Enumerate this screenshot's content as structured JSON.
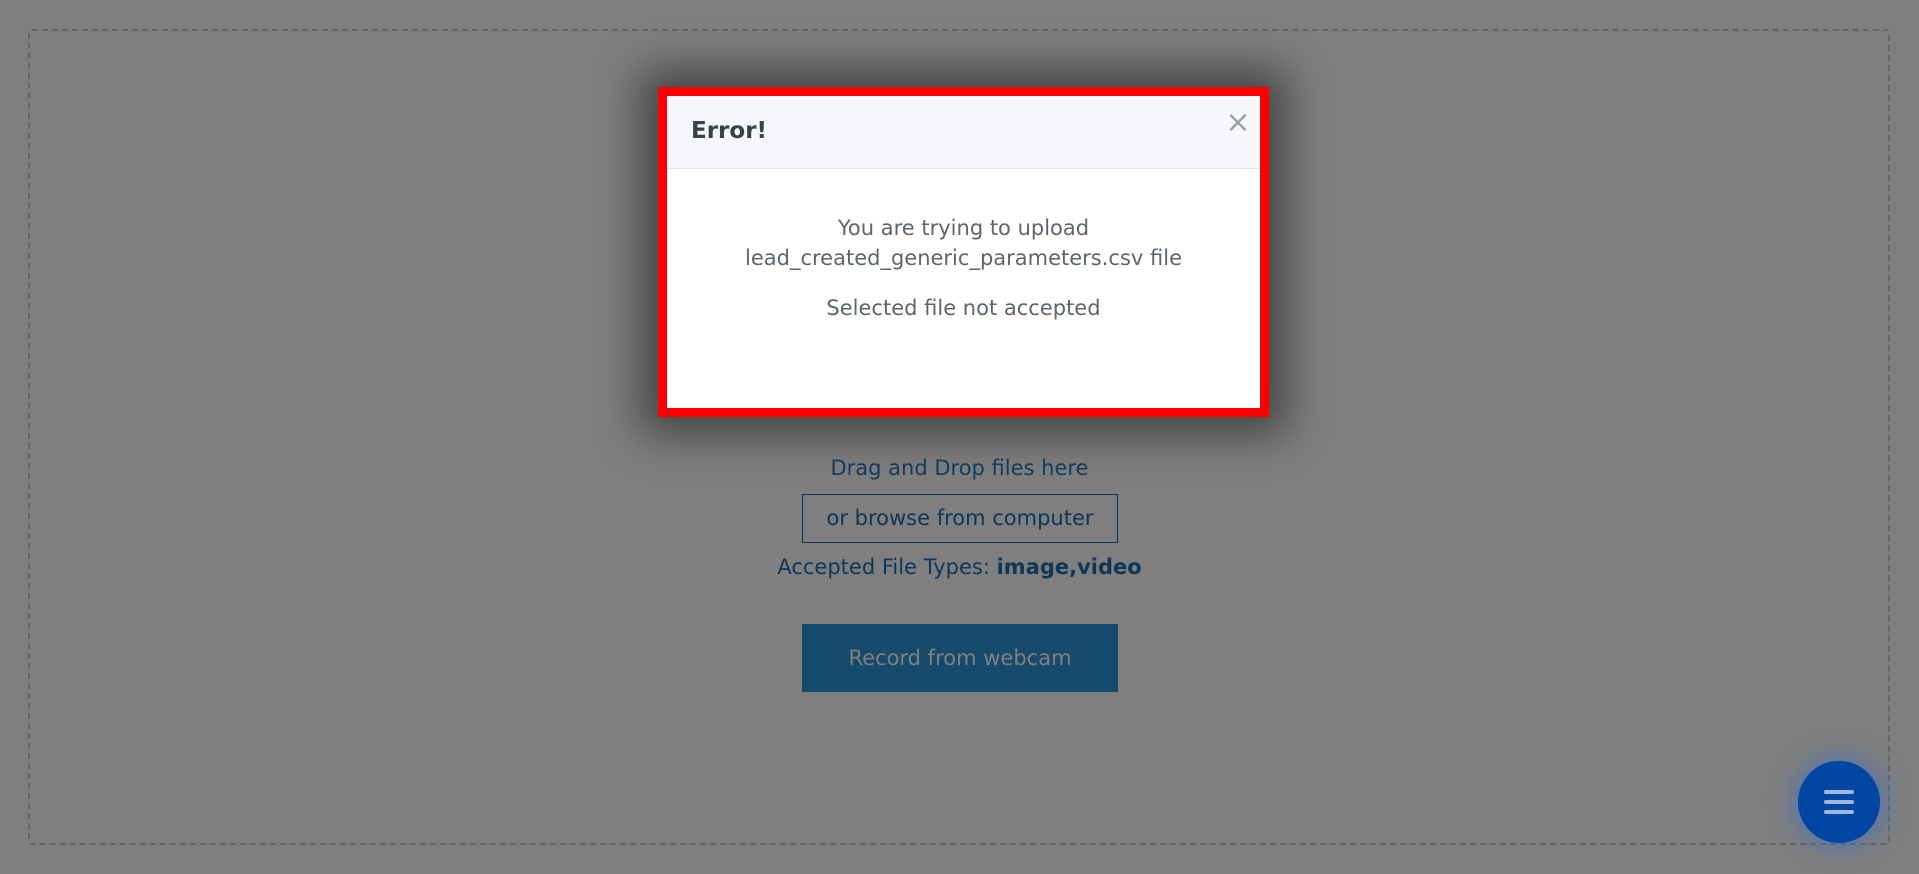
{
  "upload": {
    "drag_text": "Drag and Drop files here",
    "browse_label": "or browse from computer",
    "accepted_label": "Accepted File Types: ",
    "accepted_types": "image,video",
    "webcam_label": "Record from webcam"
  },
  "modal": {
    "title": "Error!",
    "close_symbol": "×",
    "message_line1": "You are trying to upload",
    "message_line2": "lead_created_generic_parameters.csv file",
    "message_status": "Selected file not accepted"
  },
  "fab": {
    "icon": "menu-icon"
  },
  "colors": {
    "modal_border": "#ff0000",
    "primary_button": "#2f96dc",
    "fab": "#0046a3"
  }
}
